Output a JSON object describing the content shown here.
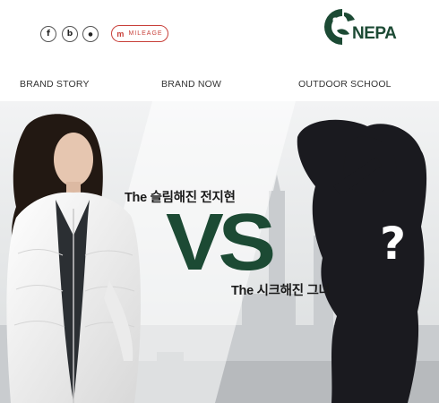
{
  "header": {
    "social": [
      {
        "icon": "facebook-icon",
        "glyph": "f"
      },
      {
        "icon": "blog-icon",
        "glyph": "b"
      },
      {
        "icon": "kakao-icon",
        "glyph": "●"
      }
    ],
    "mileage": {
      "icon": "m",
      "label": "MILEAGE"
    },
    "logo": {
      "text": "NEPA",
      "color": "#1c4a34"
    }
  },
  "nav": {
    "items": [
      "BRAND STORY",
      "BRAND NOW",
      "OUTDOOR SCHOOL"
    ]
  },
  "banner": {
    "headline_top": "The 슬림해진 전지현",
    "vs": "VS",
    "headline_bottom": "The 시크해진 그녀",
    "mystery": "?",
    "accent_color": "#1c4a34"
  }
}
